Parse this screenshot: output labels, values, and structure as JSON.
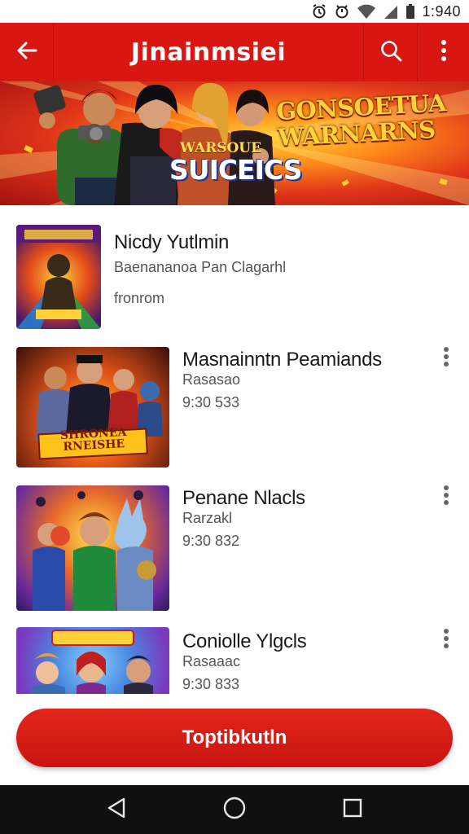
{
  "status_bar": {
    "time": "1:940"
  },
  "app_bar": {
    "title": "Jinainmsiei"
  },
  "banner": {
    "headline": "GONSOETUA WARNARNS",
    "sub_small": "WARSOUE",
    "sub_big": "SUICEICS"
  },
  "items": [
    {
      "title": "Nicdy Yutlmin",
      "subtitle": "Baenananoa Pan Clagarhl",
      "meta": "fronrom"
    },
    {
      "title": "Masnainntn Peamiands",
      "subtitle": "Rasasao",
      "meta": "9:30 533"
    },
    {
      "title": "Penane Nlacls",
      "subtitle": "Rarzakl",
      "meta": "9:30 832"
    },
    {
      "title": "Coniolle Ylgcls",
      "subtitle": "Rasaaac",
      "meta": "9:30 833"
    }
  ],
  "thumb_text": {
    "item2_caption": "SHRONEA RNEISHE"
  },
  "cta": {
    "label": "Toptibkutln"
  },
  "colors": {
    "brand": "#d81612",
    "cta": "#d61a14",
    "nav_bar": "#101010"
  },
  "icons": {
    "back": "arrow-left-icon",
    "search": "search-icon",
    "more": "more-vertical-icon",
    "nav_back": "triangle-back-icon",
    "nav_home": "circle-home-icon",
    "nav_recents": "square-recents-icon"
  }
}
